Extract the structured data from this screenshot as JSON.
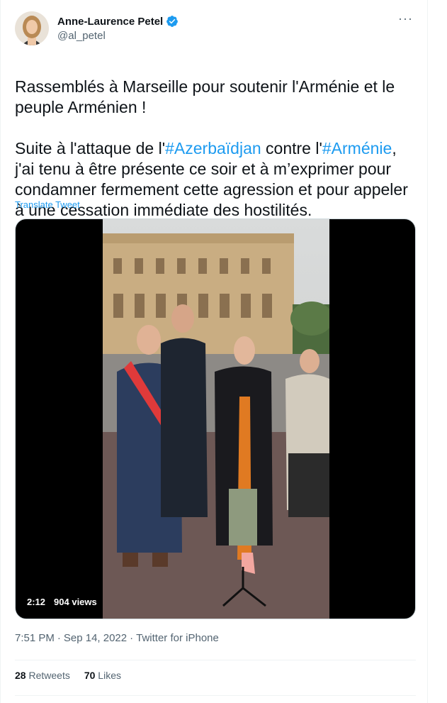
{
  "author": {
    "display_name": "Anne-Laurence Petel",
    "handle": "@al_petel",
    "verified": true,
    "verified_color": "#1d9bf0"
  },
  "more_menu": {
    "icon": "more-horizontal-icon",
    "label": "···"
  },
  "tweet": {
    "line1": "Rassemblés à Marseille pour soutenir l'Arménie et le peuple Arménien !",
    "p2_a": "Suite à l'attaque de l'",
    "hashtag1": "#Azerbaïdjan",
    "p2_b": " contre l'",
    "hashtag2": "#Arménie",
    "p2_c": ", j'ai tenu à être présente ce soir et à m’exprimer pour condamner fermement cette agression et pour appeler à une cessation immédiate des hostilités.",
    "flag_colors": [
      "#d90012",
      "#0033a0",
      "#f2a800"
    ]
  },
  "translate_label": "Translate Tweet",
  "media": {
    "duration": "2:12",
    "views": "904 views"
  },
  "meta": {
    "time": "7:51 PM",
    "separator": "·",
    "date": "Sep 14, 2022",
    "source": "Twitter for iPhone"
  },
  "stats": {
    "retweets_count": "28",
    "retweets_label": "Retweets",
    "likes_count": "70",
    "likes_label": "Likes"
  },
  "colors": {
    "accent": "#1d9bf0",
    "secondary_text": "#536471",
    "primary_text": "#0f1419"
  }
}
